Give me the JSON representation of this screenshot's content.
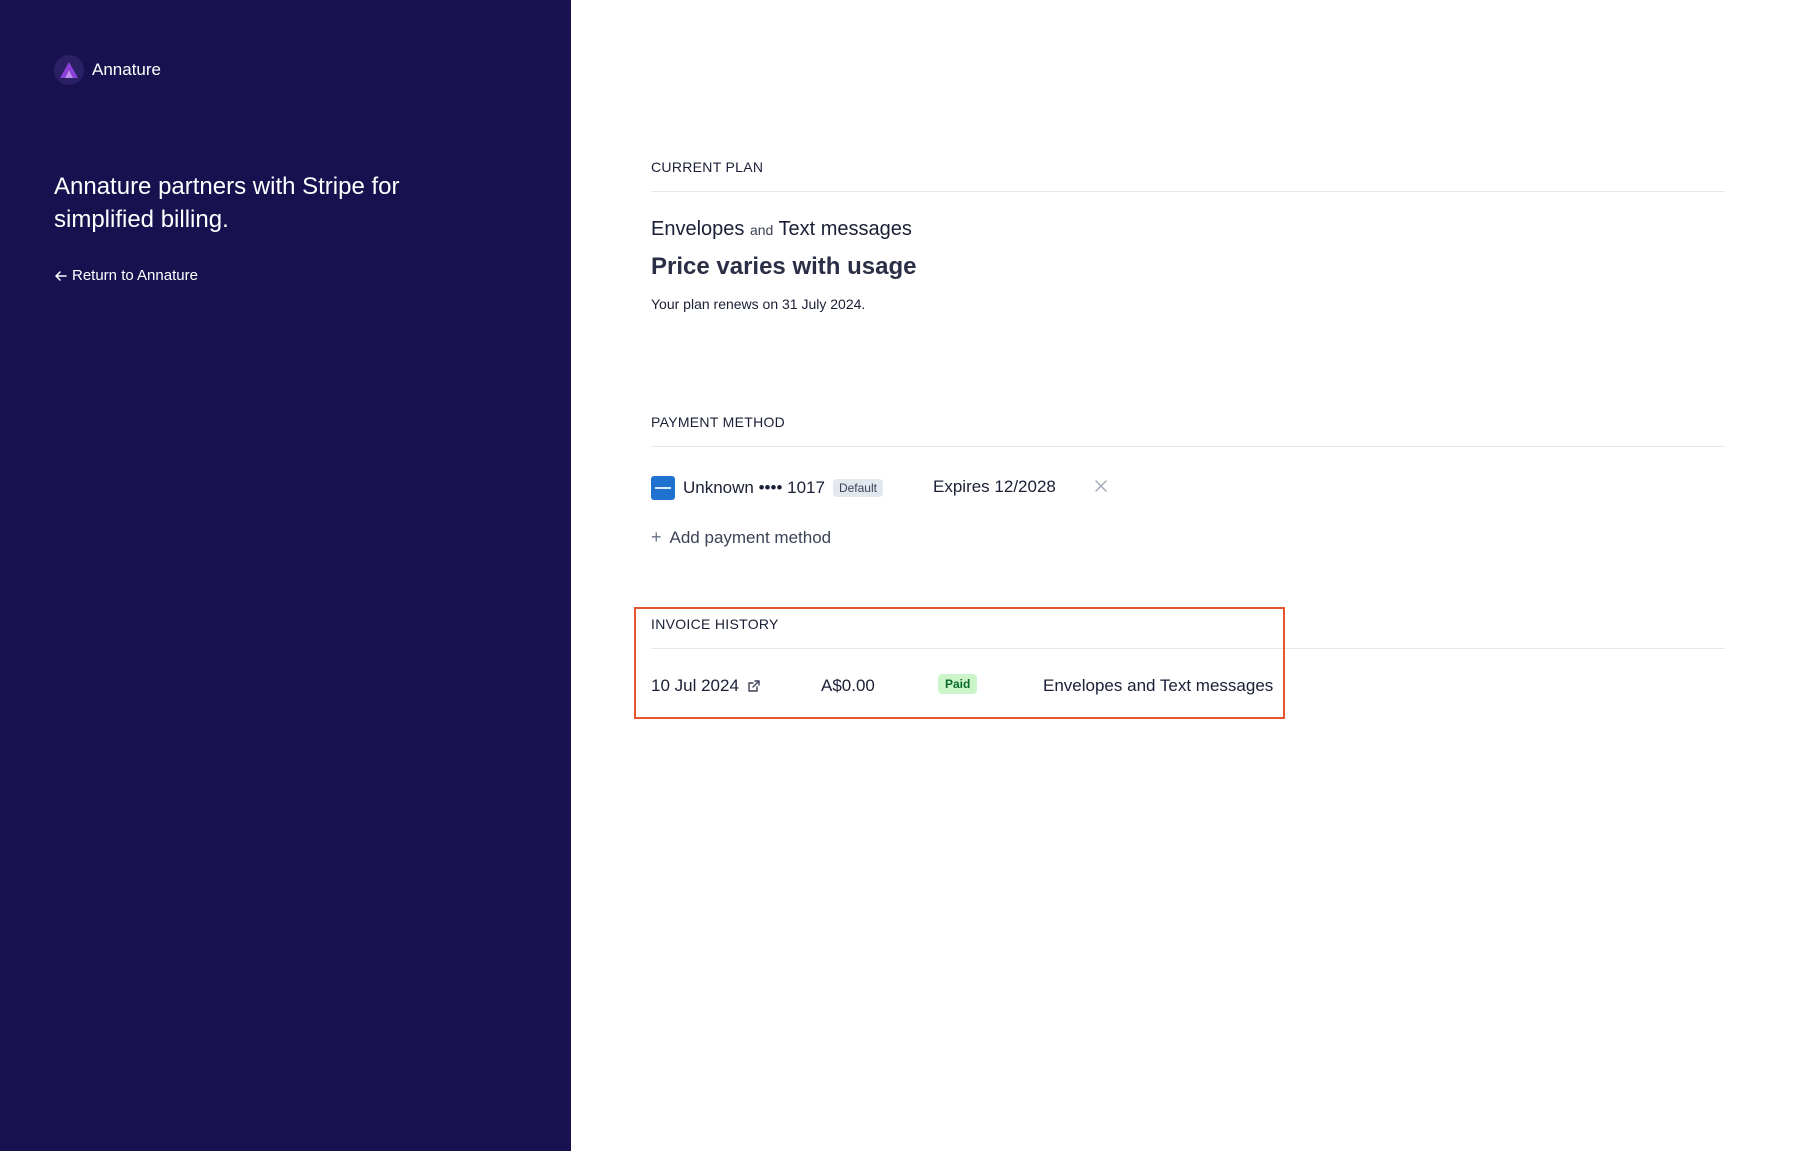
{
  "sidebar": {
    "brand": {
      "name": "Annature",
      "logo_icon": "annature-logo-icon",
      "bg_color": "#17124f"
    },
    "headline": "Annature partners with Stripe for simplified billing.",
    "return_link": "Return to Annature"
  },
  "current_plan": {
    "heading": "CURRENT PLAN",
    "product_1": "Envelopes",
    "joiner": "and",
    "product_2": "Text messages",
    "price": "Price varies with usage",
    "renewal": "Your plan renews on 31 July 2024."
  },
  "payment_method": {
    "heading": "PAYMENT METHOD",
    "card": {
      "brand_icon": "amex-card-icon",
      "label": "Unknown •••• 1017",
      "badge": "Default",
      "expires": "Expires 12/2028"
    },
    "add_label": "Add payment method"
  },
  "invoice_history": {
    "heading": "INVOICE HISTORY",
    "invoices": [
      {
        "date": "10 Jul 2024",
        "amount": "A$0.00",
        "status": "Paid",
        "description": "Envelopes and Text messages"
      }
    ]
  },
  "colors": {
    "highlight": "#e4572e",
    "paid_bg": "#cbf4c9",
    "paid_text": "#0b6b2b"
  }
}
